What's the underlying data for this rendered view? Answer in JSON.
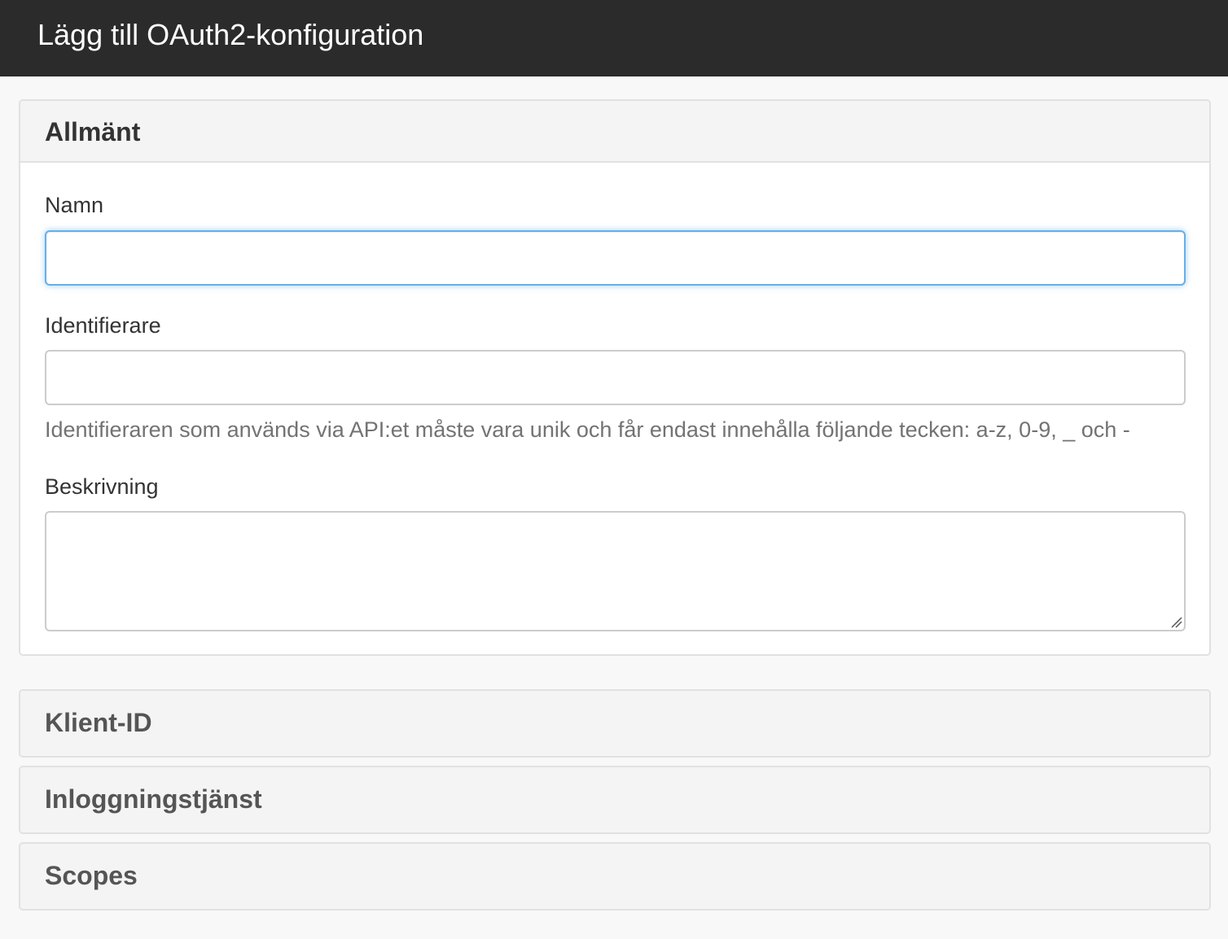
{
  "header": {
    "title": "Lägg till OAuth2-konfiguration"
  },
  "general": {
    "title": "Allmänt",
    "name_label": "Namn",
    "name_value": "",
    "identifier_label": "Identifierare",
    "identifier_value": "",
    "identifier_help": "Identifieraren som används via API:et måste vara unik och får endast innehålla följande tecken: a-z, 0-9, _ och -",
    "description_label": "Beskrivning",
    "description_value": ""
  },
  "sections": {
    "client_id": "Klient-ID",
    "login_service": "Inloggningstjänst",
    "scopes": "Scopes"
  },
  "colors": {
    "topbar": "#2b2b2b",
    "focus_border": "#66afe9",
    "panel_heading": "#f4f4f4"
  }
}
